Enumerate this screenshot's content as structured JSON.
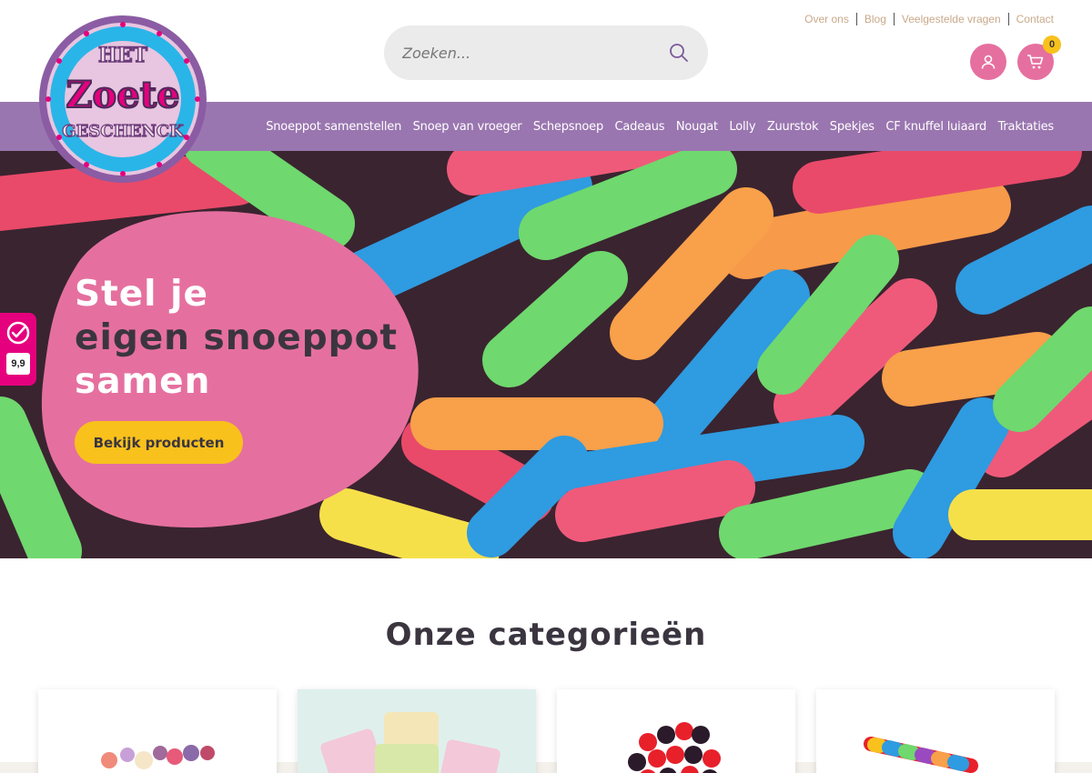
{
  "top_links": [
    "Over ons",
    "Blog",
    "Veelgestelde vragen",
    "Contact"
  ],
  "search": {
    "placeholder": "Zoeken..."
  },
  "cart": {
    "count": "0"
  },
  "logo": {
    "line1": "HET",
    "line2": "Zoete",
    "line3": "GESCHENCK"
  },
  "nav": [
    "Snoeppot samenstellen",
    "Snoep van vroeger",
    "Schepsnoep",
    "Cadeaus",
    "Nougat",
    "Lolly",
    "Zuurstok",
    "Spekjes",
    "CF knuffel luiaard",
    "Traktaties"
  ],
  "hero": {
    "title_line1": "Stel je",
    "title_line2": "eigen snoeppot",
    "title_line3": "samen",
    "cta_label": "Bekijk producten"
  },
  "rating": {
    "score": "9,9"
  },
  "categories": {
    "heading": "Onze categorieën"
  },
  "colors": {
    "pink": "#e5709f",
    "purple": "#9a76b0",
    "yellow": "#f8c11c",
    "dark": "#3b3540"
  }
}
